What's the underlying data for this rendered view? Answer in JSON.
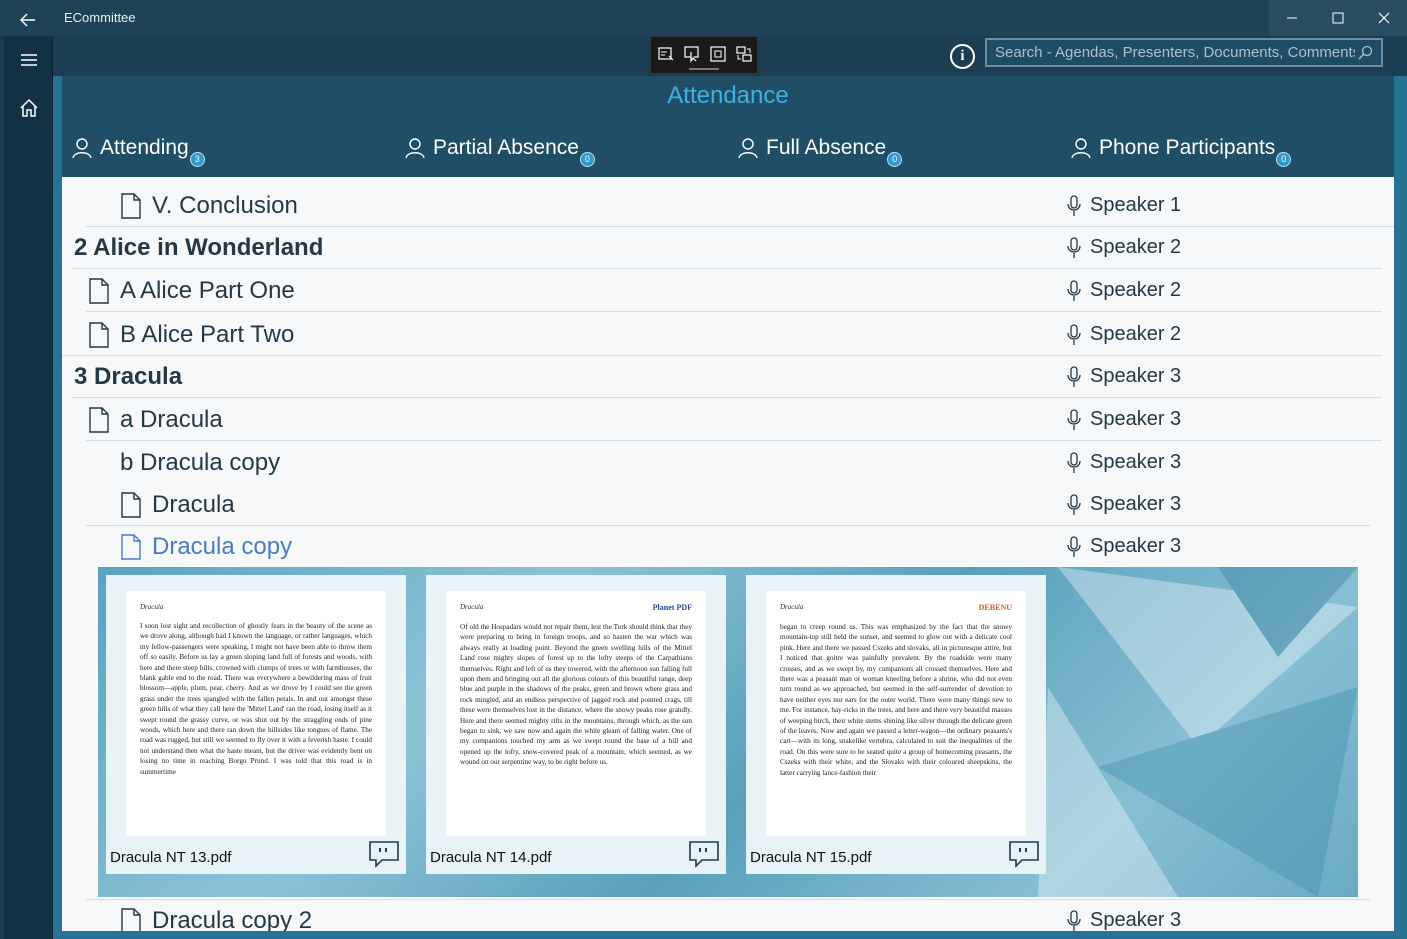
{
  "window": {
    "title": "ECommittee"
  },
  "search": {
    "placeholder": "Search - Agendas, Presenters, Documents, Comments"
  },
  "attendance": {
    "title": "Attendance",
    "columns": [
      {
        "label": "Attending",
        "count": "3"
      },
      {
        "label": "Partial Absence",
        "count": "0"
      },
      {
        "label": "Full Absence",
        "count": "0"
      },
      {
        "label": "Phone Participants",
        "count": "0"
      }
    ]
  },
  "agenda": {
    "rows": [
      {
        "label": "V. Conclusion",
        "speaker": "Speaker 1"
      },
      {
        "label": "2 Alice in Wonderland",
        "speaker": "Speaker 2"
      },
      {
        "label": "A Alice Part One",
        "speaker": "Speaker 2"
      },
      {
        "label": "B Alice Part Two",
        "speaker": "Speaker 2"
      },
      {
        "label": "3 Dracula",
        "speaker": "Speaker 3"
      },
      {
        "label": "a Dracula",
        "speaker": "Speaker 3"
      },
      {
        "label": "b Dracula copy",
        "speaker": "Speaker 3"
      },
      {
        "label": "Dracula",
        "speaker": "Speaker 3"
      },
      {
        "label": "Dracula copy",
        "speaker": "Speaker 3"
      },
      {
        "label": "Dracula copy 2",
        "speaker": "Speaker 3"
      }
    ]
  },
  "documents": [
    {
      "filename": "Dracula NT 13.pdf",
      "header": "Dracula",
      "logo": "",
      "text": "I soon lost sight and recollection of ghostly fears in the beauty of the scene as we drove along, although had I known the language, or rather languages, which my fellow-passengers were speaking, I might not have been able to throw them off so easily. Before us lay a green sloping land full of forests and woods, with here and there steep hills, crowned with clumps of trees or with farmhouses, the blank gable end to the road. There was everywhere a bewildering mass of fruit blossom—apple, plum, pear, cherry. And as we drove by I could see the green grass under the trees spangled with the fallen petals. In and out amongst these green hills of what they call here the 'Mittel Land' ran the road, losing itself as it swept round the grassy curve, or was shut out by the straggling ends of pine woods, which here and there ran down the hillsides like tongues of flame. The road was rugged, but still we seemed to fly over it with a feverish haste. I could not understand then what the haste meant, but the driver was evidently bent on losing no time in reaching Borgo Prund. I was told that this road is in summertime"
    },
    {
      "filename": "Dracula NT 14.pdf",
      "header": "Dracula",
      "logo": "Planet PDF",
      "text": "Of old the Hospadars would not repair them, lest the Turk should think that they were preparing to bring in foreign troops, and so hasten the war which was always really at loading point. Beyond the green swelling hills of the Mittel Land rose mighty slopes of forest up to the lofty steeps of the Carpathians themselves. Right and left of us they towered, with the afternoon sun falling full upon them and bringing out all the glorious colours of this beautiful range, deep blue and purple in the shadows of the peaks, green and brown where grass and rock mingled, and an endless perspective of jagged rock and pointed crags, till these were themselves lost in the distance, where the snowy peaks rose grandly. Here and there seemed mighty rifts in the mountains, through which, as the sun began to sink, we saw now and again the white gleam of falling water. One of my companions touched my arm as we swept round the base of a hill and opened up the lofty, snow-covered peak of a mountain, which seemed, as we wound on our serpentine way, to be right before us."
    },
    {
      "filename": "Dracula NT 15.pdf",
      "header": "Dracula",
      "logo": "DEBENU",
      "text": "began to creep round us. This was emphasized by the fact that the snowy mountain-top still held the sunset, and seemed to glow out with a delicate cool pink. Here and there we passed Cszeks and slovaks, all in picturesque attire, but I noticed that goitre was painfully prevalent. By the roadside were many crosses, and as we swept by, my companions all crossed themselves. Here and there was a peasant man or woman kneeling before a shrine, who did not even turn round as we approached, but seemed in the self-surrender of devotion to have neither eyes nor ears for the outer world. There were many things new to me. For instance, hay-ricks in the trees, and here and there very beautiful masses of weeping birch, their white stems shining like silver through the delicate green of the leaves. Now and again we passed a leiter-wagon—the ordinary peasants's cart—with its long, snakelike vertebra, calculated to suit the inequalities of the road. On this were sure to be seated quite a group of homecoming peasants, the Cszeks with their white, and the Slovaks with their coloured sheepskins, the latter carrying lance-fashion their"
    }
  ],
  "colors": {
    "accent": "#3cb2e0",
    "header_bg": "#1f4e66",
    "active_link": "#4a7ac8"
  },
  "icons": {
    "back": "back-arrow-icon",
    "menu": "hamburger-menu-icon",
    "home": "home-icon",
    "info": "info-icon",
    "search": "search-icon",
    "person": "person-icon",
    "document": "document-icon",
    "microphone": "microphone-icon",
    "comment": "comment-icon"
  }
}
